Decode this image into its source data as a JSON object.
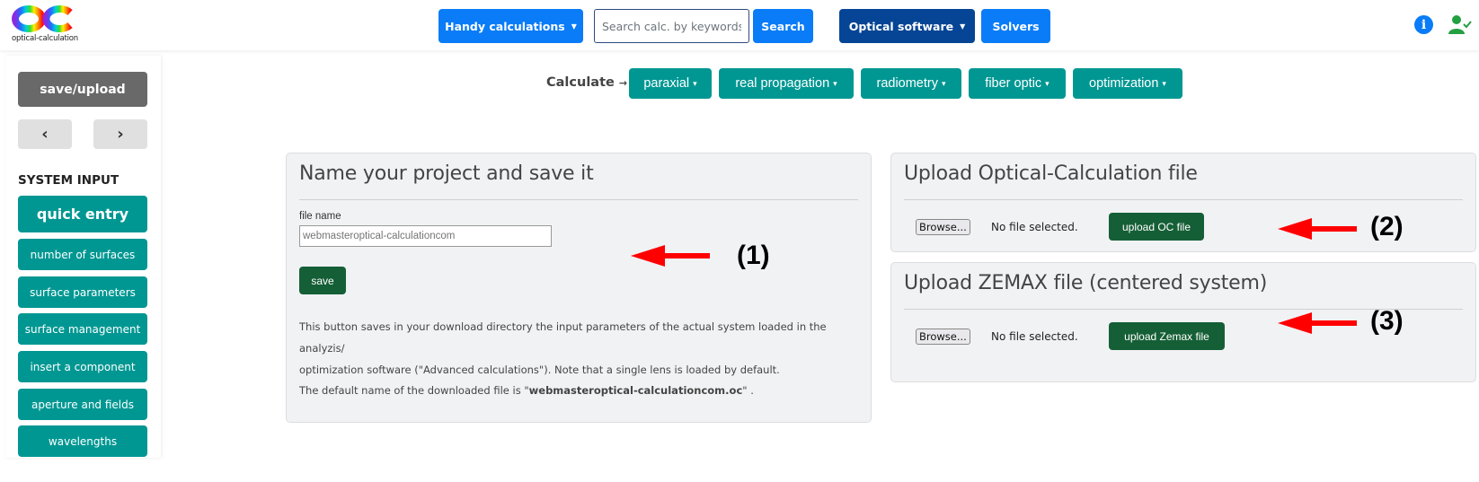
{
  "header": {
    "logo_text": "optical-calculation",
    "handy_calculations": "Handy calculations",
    "search_placeholder": "Search calc. by keywords...",
    "search_button": "Search",
    "optical_software": "Optical software",
    "solvers": "Solvers",
    "caret": "▼",
    "info_icon": "i"
  },
  "sidebar": {
    "save_upload": "save/upload",
    "prev": "‹",
    "next": "›",
    "heading": "SYSTEM INPUT",
    "quick_entry": "quick entry",
    "items": [
      {
        "label": "number of surfaces"
      },
      {
        "label": "surface parameters"
      },
      {
        "label": "surface management"
      },
      {
        "label": "insert a component"
      },
      {
        "label": "aperture and fields"
      },
      {
        "label": "wavelengths"
      }
    ]
  },
  "calculate": {
    "label": "Calculate",
    "arrow": "→",
    "caret": "▾",
    "menus": [
      {
        "label": "paraxial"
      },
      {
        "label": "real propagation"
      },
      {
        "label": "radiometry"
      },
      {
        "label": "fiber optic"
      },
      {
        "label": "optimization"
      }
    ]
  },
  "save_panel": {
    "title": "Name your project and save it",
    "field_label": "file name",
    "field_placeholder": "webmasteroptical-calculationcom",
    "save_button": "save",
    "description_line1": "This button saves in your download directory the input parameters of the actual system loaded in the analyzis/",
    "description_line2": "optimization software (\"Advanced calculations\"). Note that a single lens is loaded by default.",
    "default_name_prefix": "The default name of the downloaded file is \"",
    "default_name_value": "webmasteroptical-calculationcom.oc",
    "default_name_suffix": "\" ."
  },
  "oc_panel": {
    "title": "Upload Optical-Calculation file",
    "browse": "Browse...",
    "no_file": "No file selected.",
    "upload_button": "upload OC file"
  },
  "zemax_panel": {
    "title": "Upload ZEMAX file (centered system)",
    "browse": "Browse...",
    "no_file": "No file selected.",
    "upload_button": "upload Zemax file"
  },
  "annotations": [
    {
      "label": "(1)"
    },
    {
      "label": "(2)"
    },
    {
      "label": "(3)"
    }
  ],
  "colors": {
    "primary_blue": "#0a7cf7",
    "dark_blue": "#064595",
    "teal": "#009792",
    "dark_green": "#155f36",
    "annotation_red": "#ff0000"
  }
}
